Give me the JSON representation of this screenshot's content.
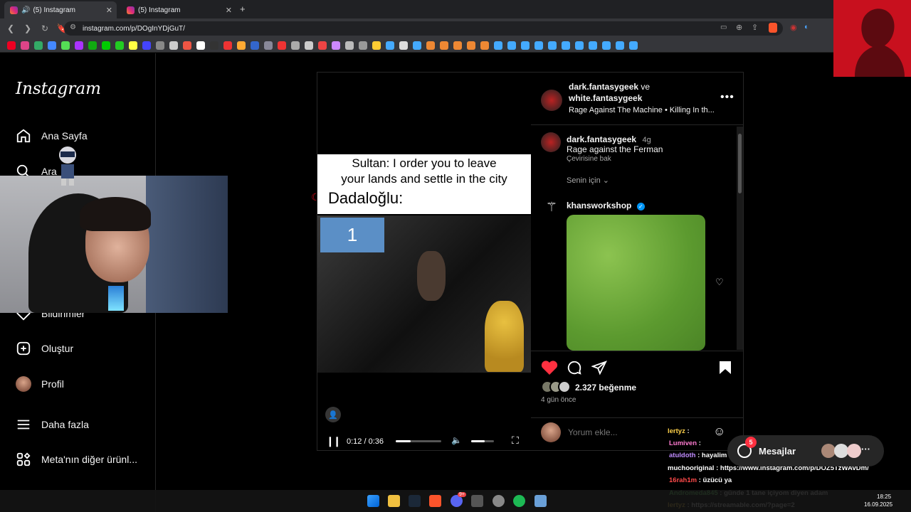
{
  "browser": {
    "tabs": [
      {
        "label": "(5) Instagram",
        "active": true
      },
      {
        "label": "(5) Instagram",
        "active": false
      }
    ],
    "new_tab": "+",
    "url": "instagram.com/p/DOgInYDjGuT/"
  },
  "sidebar": {
    "logo": "Instagram",
    "items": [
      {
        "label": "Ana Sayfa",
        "icon": "home-icon"
      },
      {
        "label": "Ara",
        "icon": "search-icon"
      },
      {
        "label": "Bildirimler",
        "icon": "heart-icon"
      },
      {
        "label": "Oluştur",
        "icon": "plus-square-icon"
      },
      {
        "label": "Profil",
        "icon": "avatar"
      },
      {
        "label": "Daha fazla",
        "icon": "menu-icon"
      },
      {
        "label": "Meta'nın diğer ürünl...",
        "icon": "meta-grid-icon"
      }
    ]
  },
  "post": {
    "video": {
      "caption_line1": "Sultan: I order you to leave",
      "caption_line2": "your lands and settle in the city",
      "caption_line3": "Dadaloğlu:",
      "badge": "1",
      "time": "0:12 / 0:36",
      "progress": 0.33,
      "volume": 0.6
    },
    "header": {
      "user1": "dark.fantasygeek",
      "conj": "ve",
      "user2": "white.fantasygeek",
      "audio": "Rage Against The Machine • Killing In th..."
    },
    "caption": {
      "user": "dark.fantasygeek",
      "age": "4g",
      "text": "Rage against the Ferman",
      "translate": "Çevirisine bak"
    },
    "for_you": "Senin için",
    "comment": {
      "user": "khansworkshop",
      "verified": true
    },
    "likes": "2.327 beğenme",
    "time_ago": "4 gün önce",
    "add_comment_placeholder": "Yorum ekle..."
  },
  "messages": {
    "label": "Mesajlar",
    "badge": "5"
  },
  "chat": [
    {
      "user": "lertyz",
      "text": ":",
      "color": "#ffd24a"
    },
    {
      "user": "Lumiven",
      "text": ":",
      "color": "#ff7bd1"
    },
    {
      "user": "atuldoth",
      "text": ": hayalim",
      "color": "#c18cff"
    },
    {
      "user": "muchooriginal",
      "text": ": https://www.instagram.com/p/DOZ5TzWAvDm/",
      "color": "#ffffff"
    },
    {
      "user": "16rah1m",
      "text": ": üzücü ya",
      "color": "#ff4a4a"
    },
    {
      "user": "Andromeda845",
      "text": ": günde 1 tane içiyom diyen adam",
      "color": "#7dff7d"
    },
    {
      "user": "lertyz",
      "text": ": https://streamable.com/?page=2",
      "color": "#ffd24a"
    }
  ],
  "taskbar": {
    "time": "18:25",
    "date": "16.09.2025",
    "discord_badge": "9+"
  },
  "colors": {
    "ig_bg": "#000000",
    "heart": "#ff3040",
    "verified": "#0095f6",
    "chrome_tab": "#35363a"
  }
}
